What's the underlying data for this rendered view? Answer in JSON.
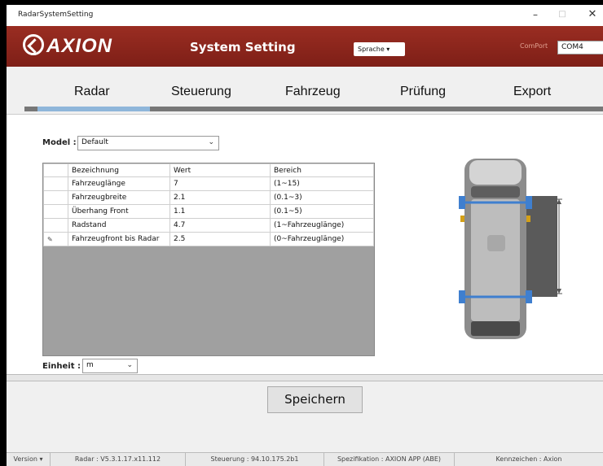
{
  "window": {
    "title": "RadarSystemSetting",
    "min": "–",
    "max": "□",
    "close": "✕"
  },
  "header": {
    "logo_text": "AXION",
    "title": "System Setting",
    "language_button": "Sprache ▾",
    "comport_label": "ComPort",
    "comport_value": "COM4"
  },
  "tabs": [
    {
      "label": "Radar",
      "selected": true
    },
    {
      "label": "Steuerung"
    },
    {
      "label": "Fahrzeug"
    },
    {
      "label": "Prüfung"
    },
    {
      "label": "Export"
    }
  ],
  "model": {
    "label": "Model :",
    "value": "Default"
  },
  "table": {
    "columns": [
      "Bezeichnung",
      "Wert",
      "Bereich"
    ],
    "rows": [
      {
        "marker": "",
        "name": "Fahrzeuglänge",
        "value": "7",
        "range": "(1~15)"
      },
      {
        "marker": "",
        "name": "Fahrzeugbreite",
        "value": "2.1",
        "range": "(0.1~3)"
      },
      {
        "marker": "",
        "name": "Überhang Front",
        "value": "1.1",
        "range": "(0.1~5)"
      },
      {
        "marker": "",
        "name": "Radstand",
        "value": "4.7",
        "range": "(1~Fahrzeuglänge)"
      },
      {
        "marker": "✎",
        "name": "Fahrzeugfront bis Radar",
        "value": "2.5",
        "range": "(0~Fahrzeuglänge)"
      }
    ]
  },
  "unit": {
    "label": "Einheit :",
    "value": "m"
  },
  "save_button": "Speichern",
  "status": {
    "version": "Version ▾",
    "radar": "Radar : V5.3.1.17.x11.112",
    "steuerung": "Steuerung : 94.10.175.2b1",
    "spezifikation": "Spezifikation : AXION APP (ABE)",
    "kennzeichen": "Kennzeichen : Axion"
  },
  "colors": {
    "header": "#8b2a1f",
    "tab_selected": "#8fb6da",
    "wheel": "#3f7fcf"
  }
}
